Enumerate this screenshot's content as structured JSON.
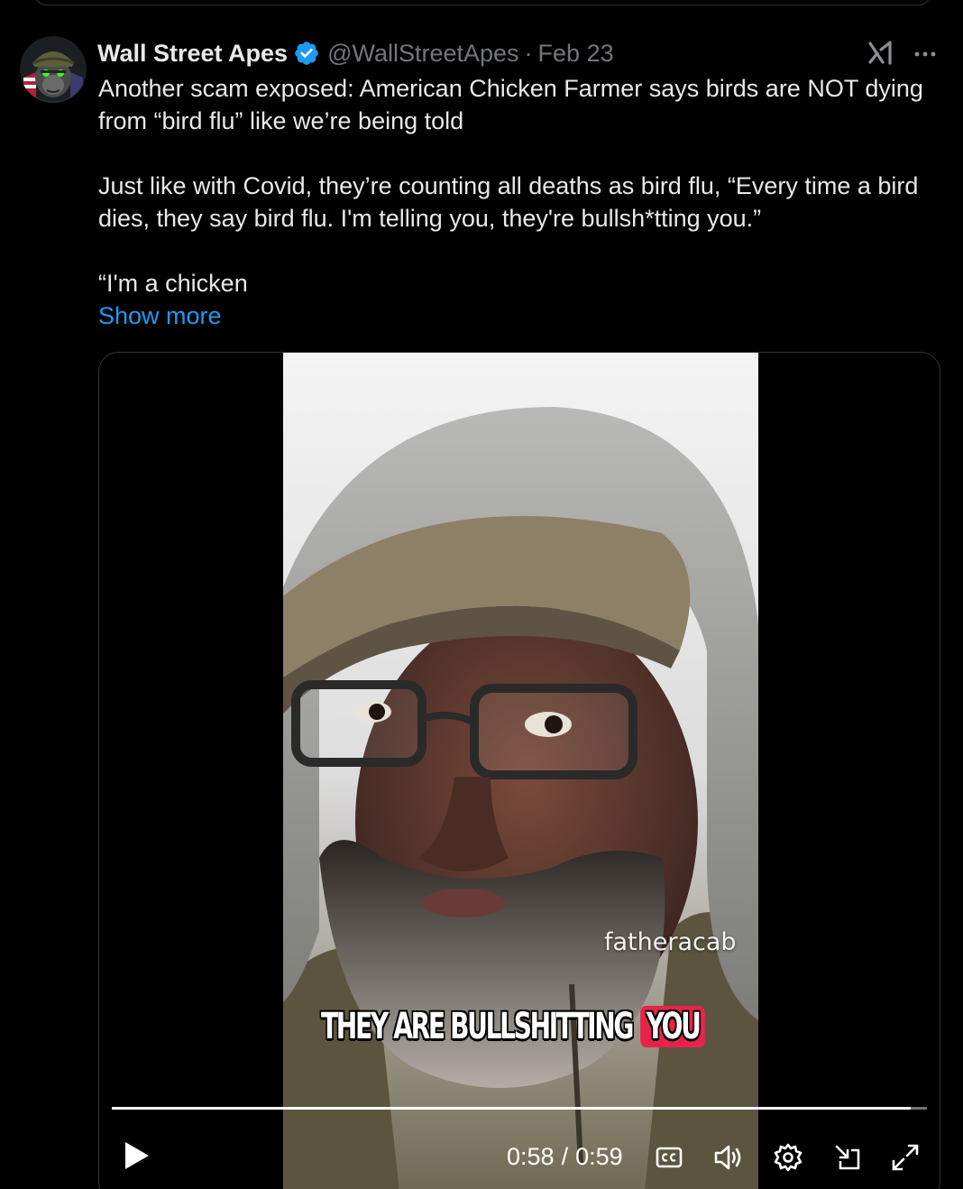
{
  "tweet": {
    "author": {
      "name": "Wall Street Apes",
      "handle": "@WallStreetApes",
      "separator": "·",
      "date": "Feb 23",
      "verified": true,
      "avatar_icon": "ape-soldier-avatar"
    },
    "text": {
      "paragraph1": "Another scam exposed: American Chicken Farmer says birds are NOT dying from “bird flu” like we’re being told",
      "paragraph2": "Just like with Covid, they’re counting all deaths as bird flu, “Every time a bird dies, they say bird flu. I'm telling you, they're bullsh*tting you.”",
      "paragraph3": "“I'm a chicken"
    },
    "show_more_label": "Show more",
    "icons": {
      "grok": "grok-icon",
      "more": "more-icon",
      "verified": "verified-badge-icon"
    }
  },
  "video": {
    "watermark": "fatheracab",
    "caption_main": "THEY ARE BULLSHITTING",
    "caption_highlight": "YOU",
    "current_time": "0:58",
    "time_separator": "/",
    "duration": "0:59",
    "progress": 0.98,
    "controls": [
      "play-icon",
      "captions-icon",
      "volume-icon",
      "settings-icon",
      "minimize-icon",
      "fullscreen-icon"
    ]
  },
  "colors": {
    "background": "#000000",
    "text": "#e7e9ea",
    "secondary_text": "#71767b",
    "link": "#1d9bf0",
    "verified": "#1d9bf0",
    "caption_highlight": "#e8234a",
    "border": "#2f3336"
  }
}
